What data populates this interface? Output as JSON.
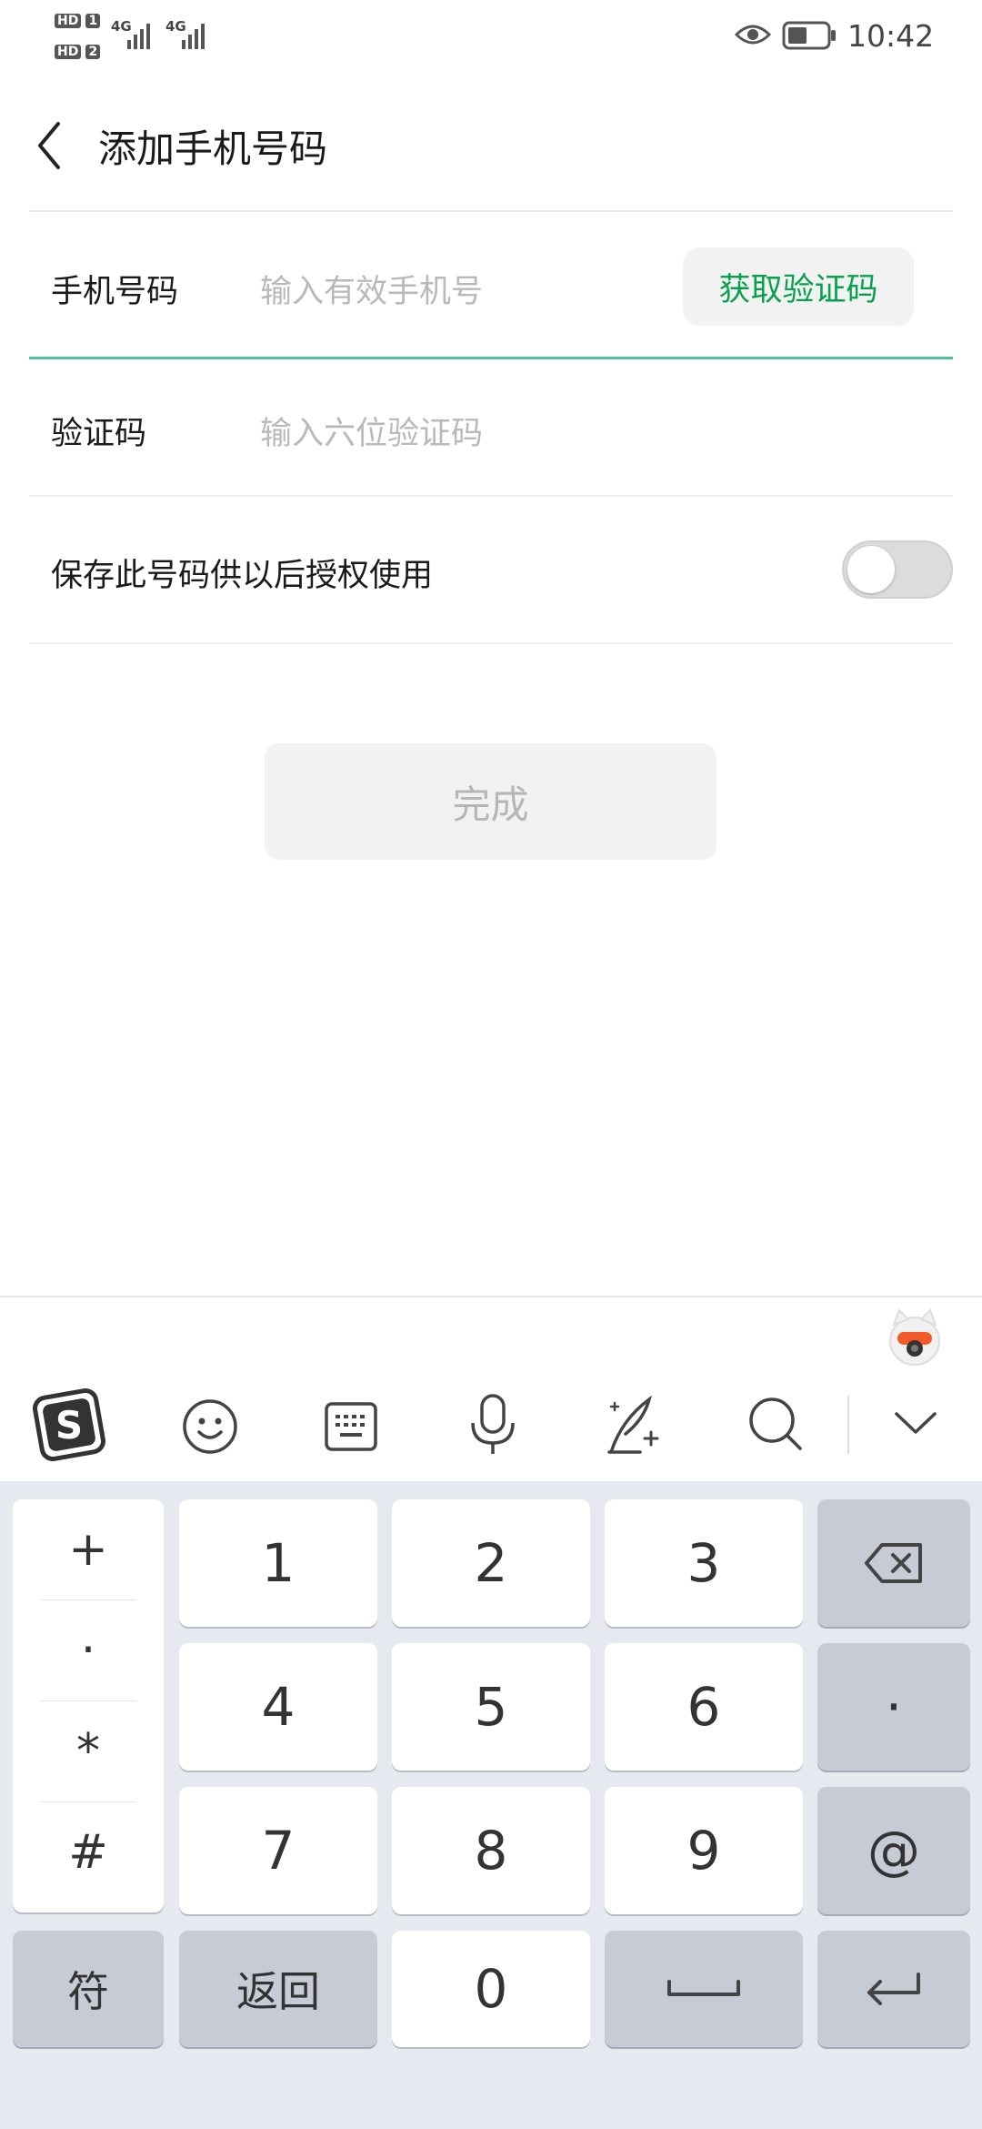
{
  "status_bar": {
    "hd1": "HD",
    "sim1": "1",
    "hd2": "HD",
    "sim2": "2",
    "net1": "4G",
    "net2": "4G",
    "time": "10:42"
  },
  "header": {
    "title": "添加手机号码"
  },
  "form": {
    "phone_label": "手机号码",
    "phone_placeholder": "输入有效手机号",
    "get_code_label": "获取验证码",
    "code_label": "验证码",
    "code_placeholder": "输入六位验证码",
    "save_label": "保存此号码供以后授权使用",
    "save_enabled": false,
    "done_label": "完成"
  },
  "colors": {
    "accent_green": "#07a14d",
    "active_underline": "#4fc29a"
  },
  "keyboard": {
    "toolbar_icons": [
      "sogou-logo-icon",
      "emoji-icon",
      "keyboard-icon",
      "microphone-icon",
      "handwriting-icon",
      "search-icon",
      "collapse-chevron-icon"
    ],
    "symbols": [
      "+",
      "·",
      "*",
      "#"
    ],
    "digits": [
      "1",
      "2",
      "3",
      "4",
      "5",
      "6",
      "7",
      "8",
      "9"
    ],
    "dot": "·",
    "at": "@",
    "sym_label": "符",
    "back_label": "返回",
    "zero": "0"
  }
}
